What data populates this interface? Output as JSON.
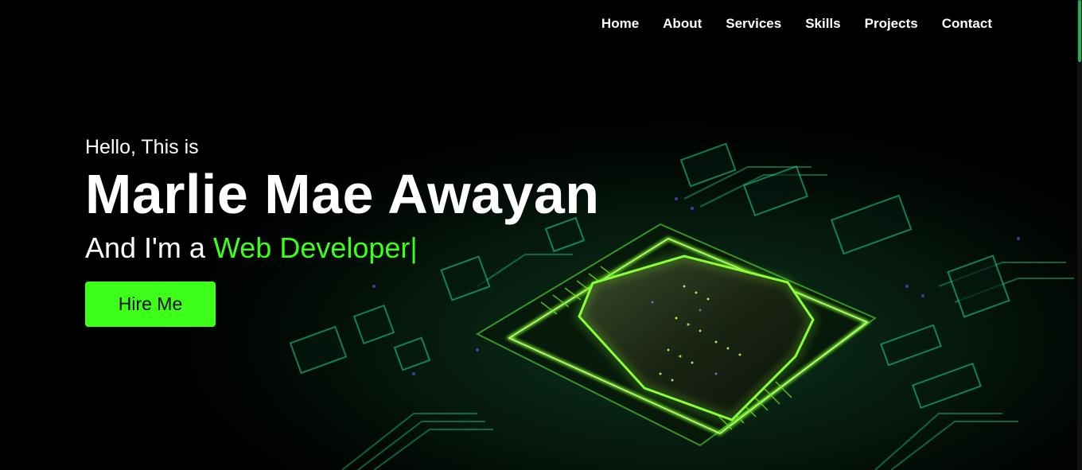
{
  "nav": {
    "items": [
      "Home",
      "About",
      "Services",
      "Skills",
      "Projects",
      "Contact"
    ]
  },
  "hero": {
    "greeting": "Hello, This is",
    "name": "Marlie Mae Awayan",
    "role_prefix": "And I'm a ",
    "role_highlight": "Web Developer",
    "cursor": "|",
    "cta_label": "Hire Me"
  },
  "colors": {
    "accent": "#3cff1a",
    "background": "#000000",
    "circuit_glow": "#7dff2a",
    "circuit_teal": "#1ec98a"
  },
  "background_image": "circuit-board-chip-icon"
}
